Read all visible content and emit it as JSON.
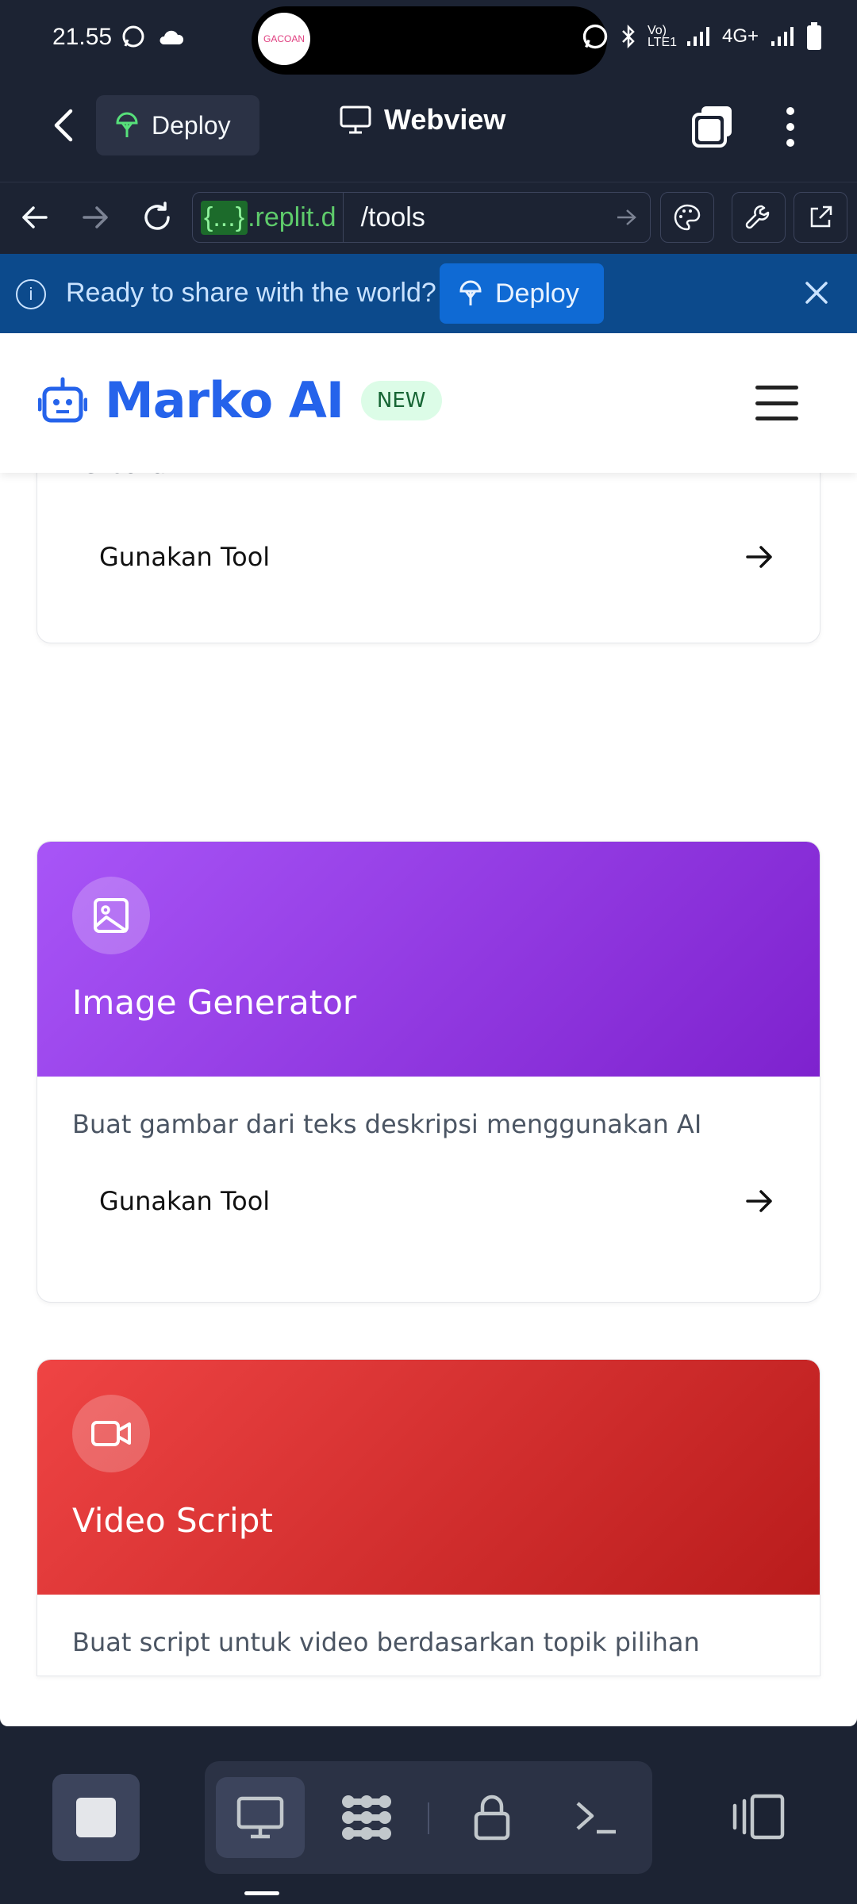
{
  "status_bar": {
    "time": "21.55",
    "network": "4G+",
    "volte": "Vo) LTE1",
    "pill_avatar_text": "GACOAN"
  },
  "header": {
    "deploy_label": "Deploy",
    "title": "Webview"
  },
  "url_bar": {
    "host_brace": "{...}",
    "host_suffix": ".replit.d",
    "path": "/tools"
  },
  "banner": {
    "info_glyph": "i",
    "text": "Ready to share with the world?",
    "deploy_label": "Deploy"
  },
  "site": {
    "brand": "Marko AI",
    "badge": "NEW"
  },
  "cards": [
    {
      "title": "",
      "description": "Buat artikel berkualitas tinggi secara instan dengan AI terbaru",
      "action": "Gunakan Tool",
      "gradient": [
        "#2563eb",
        "#1d4ed8"
      ]
    },
    {
      "title": "Image Generator",
      "description": "Buat gambar dari teks deskripsi menggunakan AI",
      "action": "Gunakan Tool",
      "icon": "image-icon",
      "gradient": [
        "#a855f7",
        "#7e22ce"
      ]
    },
    {
      "title": "Video Script",
      "description": "Buat script untuk video berdasarkan topik pilihan",
      "action": "Gunakan Tool",
      "icon": "video-icon",
      "gradient": [
        "#ef4444",
        "#b91c1c"
      ]
    }
  ],
  "colors": {
    "replit_bg": "#1c2333",
    "banner_bg": "#0c4a8c",
    "brand_blue": "#2563eb"
  }
}
